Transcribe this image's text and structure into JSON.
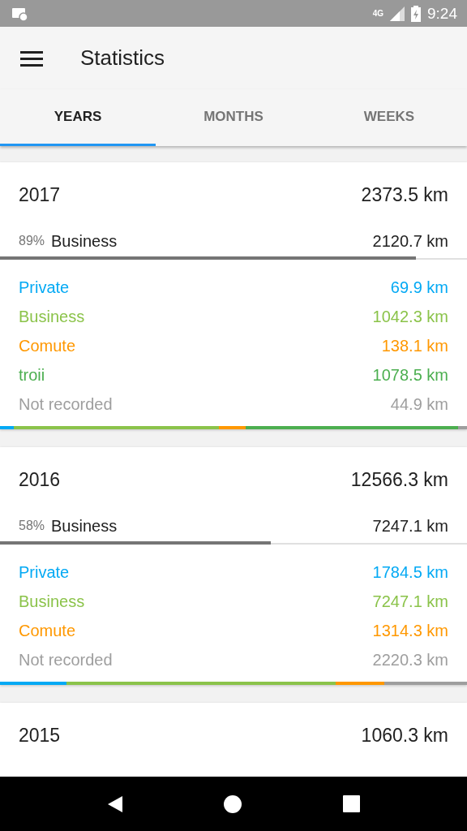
{
  "status_bar": {
    "time": "9:24",
    "network": "4G"
  },
  "app_bar": {
    "title": "Statistics"
  },
  "tabs": [
    {
      "label": "YEARS",
      "selected": true
    },
    {
      "label": "MONTHS",
      "selected": false
    },
    {
      "label": "WEEKS",
      "selected": false
    }
  ],
  "years": [
    {
      "year": "2017",
      "total": "2373.5 km",
      "summary": {
        "percent": "89%",
        "label": "Business",
        "value": "2120.7 km",
        "level": 0.89
      },
      "breakdown": [
        {
          "label": "Private",
          "value": "69.9 km",
          "color": "#03a9f4"
        },
        {
          "label": "Business",
          "value": "1042.3 km",
          "color": "#8bc34a"
        },
        {
          "label": "Comute",
          "value": "138.1 km",
          "color": "#ff9800"
        },
        {
          "label": "troii",
          "value": "1078.5 km",
          "color": "#4caf50"
        },
        {
          "label": "Not recorded",
          "value": "44.9 km",
          "color": "#9e9e9e"
        }
      ]
    },
    {
      "year": "2016",
      "total": "12566.3 km",
      "summary": {
        "percent": "58%",
        "label": "Business",
        "value": "7247.1 km",
        "level": 0.58
      },
      "breakdown": [
        {
          "label": "Private",
          "value": "1784.5 km",
          "color": "#03a9f4"
        },
        {
          "label": "Business",
          "value": "7247.1 km",
          "color": "#8bc34a"
        },
        {
          "label": "Comute",
          "value": "1314.3 km",
          "color": "#ff9800"
        },
        {
          "label": "Not recorded",
          "value": "2220.3 km",
          "color": "#9e9e9e"
        }
      ]
    },
    {
      "year": "2015",
      "total": "1060.3 km"
    }
  ]
}
